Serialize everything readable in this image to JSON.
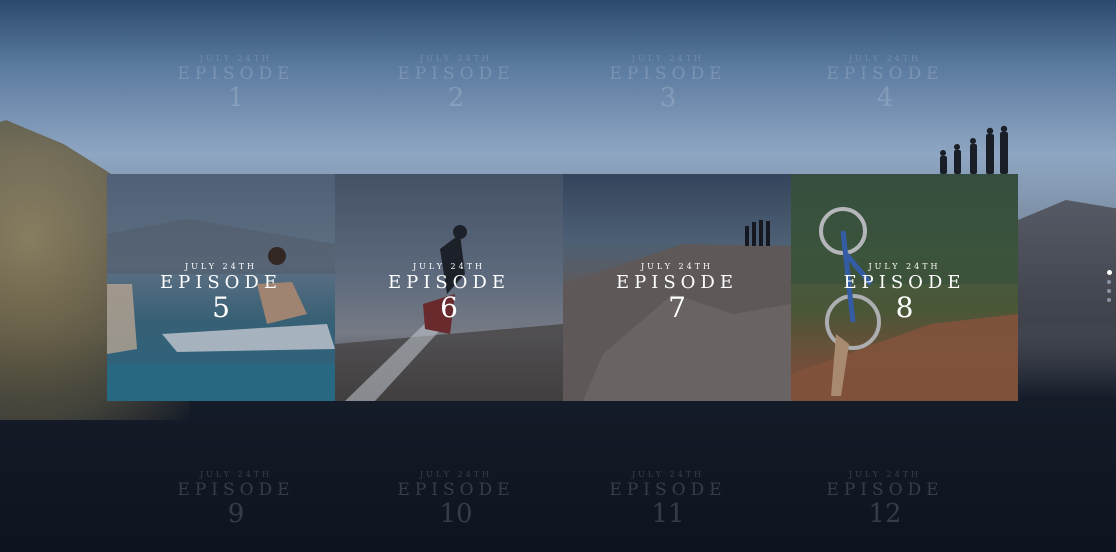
{
  "colors": {
    "accent": "#ffffff",
    "ghost_text": "#ffffff",
    "background": "#1a2233"
  },
  "ghost_top": [
    {
      "date": "JULY 24TH",
      "word": "EPISODE",
      "num": "1"
    },
    {
      "date": "JULY 24TH",
      "word": "EPISODE",
      "num": "2"
    },
    {
      "date": "JULY 24TH",
      "word": "EPISODE",
      "num": "3"
    },
    {
      "date": "JULY 24TH",
      "word": "EPISODE",
      "num": "4"
    }
  ],
  "tiles": [
    {
      "date": "JULY 24TH",
      "word": "EPISODE",
      "num": "5",
      "icon": "jet-ski-photo"
    },
    {
      "date": "JULY 24TH",
      "word": "EPISODE",
      "num": "6",
      "icon": "flyboard-photo"
    },
    {
      "date": "JULY 24TH",
      "word": "EPISODE",
      "num": "7",
      "icon": "cliff-photo"
    },
    {
      "date": "JULY 24TH",
      "word": "EPISODE",
      "num": "8",
      "icon": "mountain-bike-photo"
    }
  ],
  "ghost_bottom": [
    {
      "date": "JULY 24TH",
      "word": "EPISODE",
      "num": "9"
    },
    {
      "date": "JULY 24TH",
      "word": "EPISODE",
      "num": "10"
    },
    {
      "date": "JULY 24TH",
      "word": "EPISODE",
      "num": "11"
    },
    {
      "date": "JULY 24TH",
      "word": "EPISODE",
      "num": "12"
    }
  ],
  "pager": {
    "count": 4,
    "active_index": 0
  }
}
